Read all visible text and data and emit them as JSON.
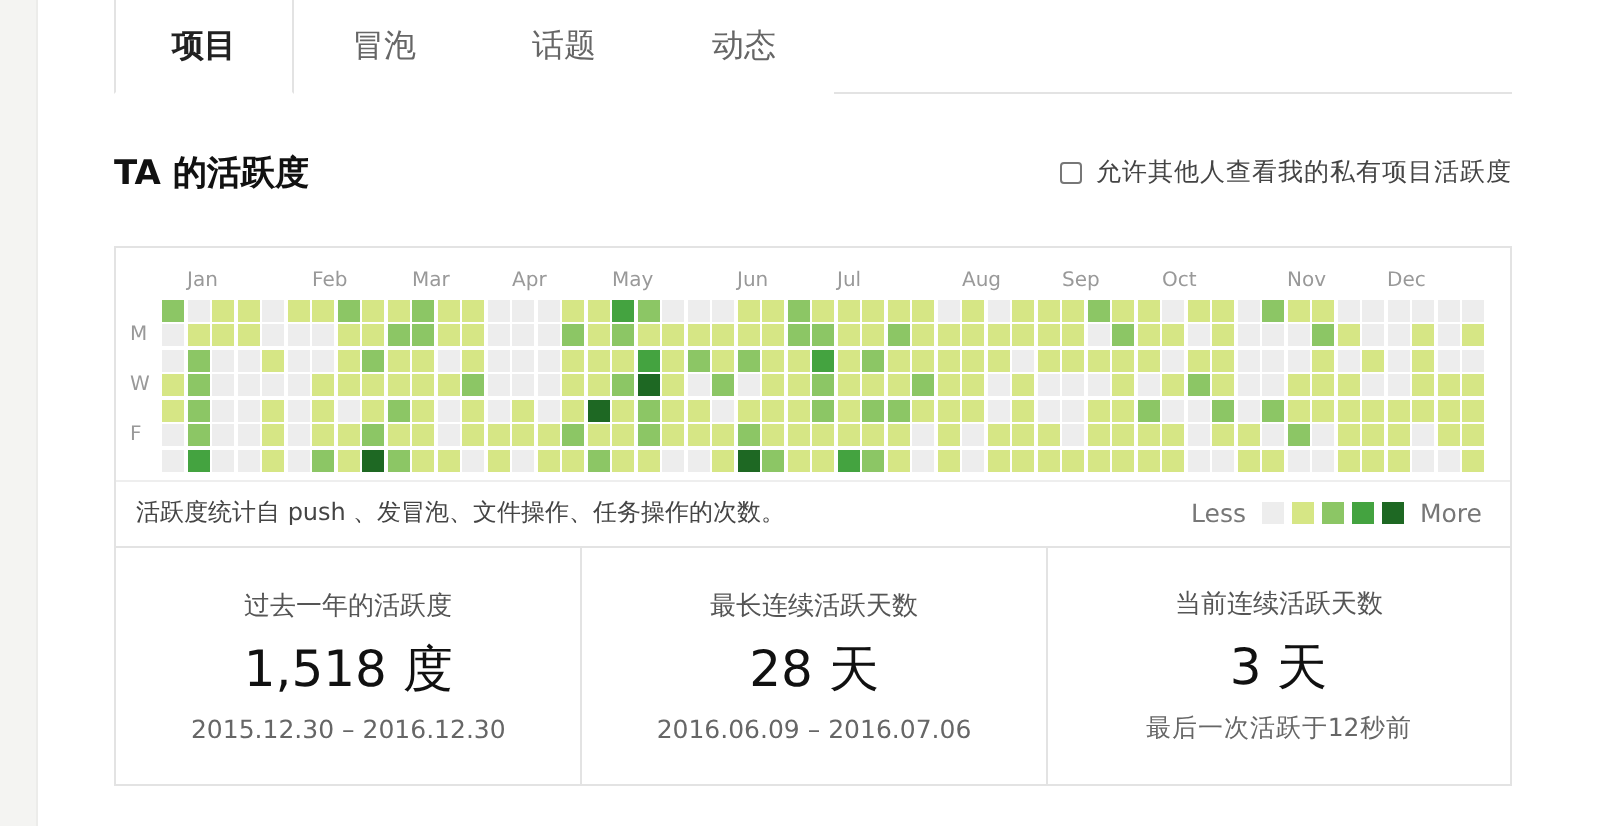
{
  "tabs": [
    {
      "label": "项目",
      "selected": true
    },
    {
      "label": "冒泡",
      "selected": false
    },
    {
      "label": "话题",
      "selected": false
    },
    {
      "label": "动态",
      "selected": false
    }
  ],
  "section": {
    "title": "TA 的活跃度",
    "privacy_option": {
      "label": "允许其他人查看我的私有项目活跃度",
      "checked": false
    }
  },
  "activity_grid": {
    "months": [
      "Jan",
      "Feb",
      "Mar",
      "Apr",
      "May",
      "Jun",
      "Jul",
      "Aug",
      "Sep",
      "Oct",
      "Nov",
      "Dec"
    ],
    "day_labels": [
      "M",
      "W",
      "F"
    ],
    "rows": [
      {
        "cells": [
          {
            "color": "#8cc665"
          },
          {
            "color": "#ededed"
          },
          {
            "color": "#d6e685"
          },
          {
            "color": "#d6e685"
          },
          {
            "color": "#ededed"
          },
          {
            "color": "#d6e685"
          },
          {
            "color": "#d6e685"
          },
          {
            "color": "#8cc665"
          },
          {
            "color": "#d6e685"
          },
          {
            "color": "#d6e685"
          },
          {
            "color": "#8cc665"
          },
          {
            "color": "#d6e685"
          },
          {
            "color": "#d6e685"
          },
          {
            "color": "#ededed"
          },
          {
            "color": "#ededed"
          },
          {
            "color": "#ededed"
          },
          {
            "color": "#d6e685"
          },
          {
            "color": "#d6e685"
          },
          {
            "color": "#44a340"
          },
          {
            "color": "#8cc665"
          },
          {
            "color": "#ededed"
          },
          {
            "color": "#ededed"
          },
          {
            "color": "#ededed"
          },
          {
            "color": "#d6e685"
          },
          {
            "color": "#d6e685"
          },
          {
            "color": "#8cc665"
          },
          {
            "color": "#d6e685"
          },
          {
            "color": "#d6e685"
          },
          {
            "color": "#d6e685"
          },
          {
            "color": "#d6e685"
          },
          {
            "color": "#d6e685"
          },
          {
            "color": "#ededed"
          },
          {
            "color": "#d6e685"
          },
          {
            "color": "#ededed"
          },
          {
            "color": "#d6e685"
          },
          {
            "color": "#d6e685"
          },
          {
            "color": "#d6e685"
          },
          {
            "color": "#8cc665"
          },
          {
            "color": "#d6e685"
          },
          {
            "color": "#d6e685"
          },
          {
            "color": "#ededed"
          },
          {
            "color": "#d6e685"
          },
          {
            "color": "#d6e685"
          },
          {
            "color": "#ededed"
          },
          {
            "color": "#8cc665"
          },
          {
            "color": "#d6e685"
          },
          {
            "color": "#d6e685"
          },
          {
            "color": "#ededed"
          },
          {
            "color": "#ededed"
          },
          {
            "color": "#ededed"
          },
          {
            "color": "#ededed"
          },
          {
            "color": "#ededed"
          },
          {
            "color": "#ededed"
          }
        ]
      },
      {
        "cells": [
          {
            "color": "#ededed"
          },
          {
            "color": "#d6e685"
          },
          {
            "color": "#d6e685"
          },
          {
            "color": "#d6e685"
          },
          {
            "color": "#ededed"
          },
          {
            "color": "#ededed"
          },
          {
            "color": "#ededed"
          },
          {
            "color": "#d6e685"
          },
          {
            "color": "#d6e685"
          },
          {
            "color": "#8cc665"
          },
          {
            "color": "#8cc665"
          },
          {
            "color": "#d6e685"
          },
          {
            "color": "#d6e685"
          },
          {
            "color": "#ededed"
          },
          {
            "color": "#ededed"
          },
          {
            "color": "#ededed"
          },
          {
            "color": "#8cc665"
          },
          {
            "color": "#d6e685"
          },
          {
            "color": "#8cc665"
          },
          {
            "color": "#d6e685"
          },
          {
            "color": "#d6e685"
          },
          {
            "color": "#d6e685"
          },
          {
            "color": "#d6e685"
          },
          {
            "color": "#d6e685"
          },
          {
            "color": "#d6e685"
          },
          {
            "color": "#8cc665"
          },
          {
            "color": "#8cc665"
          },
          {
            "color": "#d6e685"
          },
          {
            "color": "#d6e685"
          },
          {
            "color": "#8cc665"
          },
          {
            "color": "#d6e685"
          },
          {
            "color": "#d6e685"
          },
          {
            "color": "#d6e685"
          },
          {
            "color": "#d6e685"
          },
          {
            "color": "#d6e685"
          },
          {
            "color": "#d6e685"
          },
          {
            "color": "#d6e685"
          },
          {
            "color": "#ededed"
          },
          {
            "color": "#8cc665"
          },
          {
            "color": "#d6e685"
          },
          {
            "color": "#d6e685"
          },
          {
            "color": "#ededed"
          },
          {
            "color": "#d6e685"
          },
          {
            "color": "#ededed"
          },
          {
            "color": "#ededed"
          },
          {
            "color": "#ededed"
          },
          {
            "color": "#8cc665"
          },
          {
            "color": "#d6e685"
          },
          {
            "color": "#ededed"
          },
          {
            "color": "#ededed"
          },
          {
            "color": "#d6e685"
          },
          {
            "color": "#ededed"
          },
          {
            "color": "#d6e685"
          }
        ]
      },
      {
        "cells": [
          {
            "color": "#ededed"
          },
          {
            "color": "#8cc665"
          },
          {
            "color": "#ededed"
          },
          {
            "color": "#ededed"
          },
          {
            "color": "#d6e685"
          },
          {
            "color": "#ededed"
          },
          {
            "color": "#ededed"
          },
          {
            "color": "#d6e685"
          },
          {
            "color": "#8cc665"
          },
          {
            "color": "#d6e685"
          },
          {
            "color": "#d6e685"
          },
          {
            "color": "#ededed"
          },
          {
            "color": "#d6e685"
          },
          {
            "color": "#ededed"
          },
          {
            "color": "#ededed"
          },
          {
            "color": "#ededed"
          },
          {
            "color": "#d6e685"
          },
          {
            "color": "#d6e685"
          },
          {
            "color": "#d6e685"
          },
          {
            "color": "#44a340"
          },
          {
            "color": "#d6e685"
          },
          {
            "color": "#8cc665"
          },
          {
            "color": "#d6e685"
          },
          {
            "color": "#8cc665"
          },
          {
            "color": "#d6e685"
          },
          {
            "color": "#d6e685"
          },
          {
            "color": "#44a340"
          },
          {
            "color": "#d6e685"
          },
          {
            "color": "#8cc665"
          },
          {
            "color": "#d6e685"
          },
          {
            "color": "#d6e685"
          },
          {
            "color": "#d6e685"
          },
          {
            "color": "#d6e685"
          },
          {
            "color": "#d6e685"
          },
          {
            "color": "#ededed"
          },
          {
            "color": "#d6e685"
          },
          {
            "color": "#d6e685"
          },
          {
            "color": "#d6e685"
          },
          {
            "color": "#d6e685"
          },
          {
            "color": "#d6e685"
          },
          {
            "color": "#ededed"
          },
          {
            "color": "#d6e685"
          },
          {
            "color": "#d6e685"
          },
          {
            "color": "#ededed"
          },
          {
            "color": "#ededed"
          },
          {
            "color": "#ededed"
          },
          {
            "color": "#d6e685"
          },
          {
            "color": "#ededed"
          },
          {
            "color": "#d6e685"
          },
          {
            "color": "#ededed"
          },
          {
            "color": "#d6e685"
          },
          {
            "color": "#ededed"
          },
          {
            "color": "#ededed"
          }
        ]
      },
      {
        "cells": [
          {
            "color": "#d6e685"
          },
          {
            "color": "#8cc665"
          },
          {
            "color": "#ededed"
          },
          {
            "color": "#ededed"
          },
          {
            "color": "#ededed"
          },
          {
            "color": "#ededed"
          },
          {
            "color": "#d6e685"
          },
          {
            "color": "#d6e685"
          },
          {
            "color": "#d6e685"
          },
          {
            "color": "#d6e685"
          },
          {
            "color": "#d6e685"
          },
          {
            "color": "#d6e685"
          },
          {
            "color": "#8cc665"
          },
          {
            "color": "#ededed"
          },
          {
            "color": "#ededed"
          },
          {
            "color": "#ededed"
          },
          {
            "color": "#d6e685"
          },
          {
            "color": "#d6e685"
          },
          {
            "color": "#8cc665"
          },
          {
            "color": "#1e6823"
          },
          {
            "color": "#d6e685"
          },
          {
            "color": "#ededed"
          },
          {
            "color": "#8cc665"
          },
          {
            "color": "#ededed"
          },
          {
            "color": "#d6e685"
          },
          {
            "color": "#d6e685"
          },
          {
            "color": "#8cc665"
          },
          {
            "color": "#d6e685"
          },
          {
            "color": "#d6e685"
          },
          {
            "color": "#d6e685"
          },
          {
            "color": "#8cc665"
          },
          {
            "color": "#d6e685"
          },
          {
            "color": "#d6e685"
          },
          {
            "color": "#ededed"
          },
          {
            "color": "#d6e685"
          },
          {
            "color": "#ededed"
          },
          {
            "color": "#ededed"
          },
          {
            "color": "#ededed"
          },
          {
            "color": "#d6e685"
          },
          {
            "color": "#ededed"
          },
          {
            "color": "#d6e685"
          },
          {
            "color": "#8cc665"
          },
          {
            "color": "#d6e685"
          },
          {
            "color": "#ededed"
          },
          {
            "color": "#ededed"
          },
          {
            "color": "#d6e685"
          },
          {
            "color": "#d6e685"
          },
          {
            "color": "#d6e685"
          },
          {
            "color": "#ededed"
          },
          {
            "color": "#ededed"
          },
          {
            "color": "#d6e685"
          },
          {
            "color": "#d6e685"
          },
          {
            "color": "#d6e685"
          }
        ]
      },
      {
        "cells": [
          {
            "color": "#d6e685"
          },
          {
            "color": "#8cc665"
          },
          {
            "color": "#ededed"
          },
          {
            "color": "#ededed"
          },
          {
            "color": "#d6e685"
          },
          {
            "color": "#ededed"
          },
          {
            "color": "#d6e685"
          },
          {
            "color": "#ededed"
          },
          {
            "color": "#d6e685"
          },
          {
            "color": "#8cc665"
          },
          {
            "color": "#d6e685"
          },
          {
            "color": "#ededed"
          },
          {
            "color": "#d6e685"
          },
          {
            "color": "#ededed"
          },
          {
            "color": "#d6e685"
          },
          {
            "color": "#ededed"
          },
          {
            "color": "#d6e685"
          },
          {
            "color": "#1e6823"
          },
          {
            "color": "#d6e685"
          },
          {
            "color": "#8cc665"
          },
          {
            "color": "#d6e685"
          },
          {
            "color": "#d6e685"
          },
          {
            "color": "#ededed"
          },
          {
            "color": "#d6e685"
          },
          {
            "color": "#d6e685"
          },
          {
            "color": "#d6e685"
          },
          {
            "color": "#8cc665"
          },
          {
            "color": "#d6e685"
          },
          {
            "color": "#8cc665"
          },
          {
            "color": "#8cc665"
          },
          {
            "color": "#d6e685"
          },
          {
            "color": "#d6e685"
          },
          {
            "color": "#d6e685"
          },
          {
            "color": "#ededed"
          },
          {
            "color": "#d6e685"
          },
          {
            "color": "#ededed"
          },
          {
            "color": "#ededed"
          },
          {
            "color": "#d6e685"
          },
          {
            "color": "#d6e685"
          },
          {
            "color": "#8cc665"
          },
          {
            "color": "#ededed"
          },
          {
            "color": "#ededed"
          },
          {
            "color": "#8cc665"
          },
          {
            "color": "#ededed"
          },
          {
            "color": "#8cc665"
          },
          {
            "color": "#d6e685"
          },
          {
            "color": "#d6e685"
          },
          {
            "color": "#d6e685"
          },
          {
            "color": "#d6e685"
          },
          {
            "color": "#d6e685"
          },
          {
            "color": "#d6e685"
          },
          {
            "color": "#d6e685"
          },
          {
            "color": "#d6e685"
          }
        ]
      },
      {
        "cells": [
          {
            "color": "#ededed"
          },
          {
            "color": "#8cc665"
          },
          {
            "color": "#ededed"
          },
          {
            "color": "#ededed"
          },
          {
            "color": "#d6e685"
          },
          {
            "color": "#ededed"
          },
          {
            "color": "#d6e685"
          },
          {
            "color": "#d6e685"
          },
          {
            "color": "#8cc665"
          },
          {
            "color": "#d6e685"
          },
          {
            "color": "#d6e685"
          },
          {
            "color": "#ededed"
          },
          {
            "color": "#d6e685"
          },
          {
            "color": "#d6e685"
          },
          {
            "color": "#d6e685"
          },
          {
            "color": "#d6e685"
          },
          {
            "color": "#8cc665"
          },
          {
            "color": "#d6e685"
          },
          {
            "color": "#d6e685"
          },
          {
            "color": "#8cc665"
          },
          {
            "color": "#d6e685"
          },
          {
            "color": "#d6e685"
          },
          {
            "color": "#d6e685"
          },
          {
            "color": "#8cc665"
          },
          {
            "color": "#d6e685"
          },
          {
            "color": "#d6e685"
          },
          {
            "color": "#d6e685"
          },
          {
            "color": "#d6e685"
          },
          {
            "color": "#d6e685"
          },
          {
            "color": "#d6e685"
          },
          {
            "color": "#ededed"
          },
          {
            "color": "#d6e685"
          },
          {
            "color": "#ededed"
          },
          {
            "color": "#d6e685"
          },
          {
            "color": "#d6e685"
          },
          {
            "color": "#d6e685"
          },
          {
            "color": "#ededed"
          },
          {
            "color": "#d6e685"
          },
          {
            "color": "#d6e685"
          },
          {
            "color": "#d6e685"
          },
          {
            "color": "#d6e685"
          },
          {
            "color": "#ededed"
          },
          {
            "color": "#d6e685"
          },
          {
            "color": "#d6e685"
          },
          {
            "color": "#ededed"
          },
          {
            "color": "#8cc665"
          },
          {
            "color": "#ededed"
          },
          {
            "color": "#d6e685"
          },
          {
            "color": "#d6e685"
          },
          {
            "color": "#d6e685"
          },
          {
            "color": "#ededed"
          },
          {
            "color": "#d6e685"
          },
          {
            "color": "#d6e685"
          }
        ]
      },
      {
        "cells": [
          {
            "color": "#ededed"
          },
          {
            "color": "#44a340"
          },
          {
            "color": "#ededed"
          },
          {
            "color": "#ededed"
          },
          {
            "color": "#d6e685"
          },
          {
            "color": "#ededed"
          },
          {
            "color": "#8cc665"
          },
          {
            "color": "#d6e685"
          },
          {
            "color": "#1e6823"
          },
          {
            "color": "#8cc665"
          },
          {
            "color": "#d6e685"
          },
          {
            "color": "#d6e685"
          },
          {
            "color": "#ededed"
          },
          {
            "color": "#d6e685"
          },
          {
            "color": "#ededed"
          },
          {
            "color": "#d6e685"
          },
          {
            "color": "#d6e685"
          },
          {
            "color": "#8cc665"
          },
          {
            "color": "#d6e685"
          },
          {
            "color": "#d6e685"
          },
          {
            "color": "#ededed"
          },
          {
            "color": "#ededed"
          },
          {
            "color": "#d6e685"
          },
          {
            "color": "#1e6823"
          },
          {
            "color": "#8cc665"
          },
          {
            "color": "#d6e685"
          },
          {
            "color": "#d6e685"
          },
          {
            "color": "#44a340"
          },
          {
            "color": "#8cc665"
          },
          {
            "color": "#d6e685"
          },
          {
            "color": "#ededed"
          },
          {
            "color": "#d6e685"
          },
          {
            "color": "#ededed"
          },
          {
            "color": "#d6e685"
          },
          {
            "color": "#d6e685"
          },
          {
            "color": "#d6e685"
          },
          {
            "color": "#d6e685"
          },
          {
            "color": "#d6e685"
          },
          {
            "color": "#d6e685"
          },
          {
            "color": "#d6e685"
          },
          {
            "color": "#d6e685"
          },
          {
            "color": "#ededed"
          },
          {
            "color": "#ededed"
          },
          {
            "color": "#d6e685"
          },
          {
            "color": "#d6e685"
          },
          {
            "color": "#ededed"
          },
          {
            "color": "#ededed"
          },
          {
            "color": "#d6e685"
          },
          {
            "color": "#d6e685"
          },
          {
            "color": "#d6e685"
          },
          {
            "color": "#ededed"
          },
          {
            "color": "#ededed"
          },
          {
            "color": "#d6e685"
          }
        ]
      }
    ]
  },
  "caption": "活跃度统计自 push 、发冒泡、文件操作、任务操作的次数。",
  "legend": {
    "less": "Less",
    "more": "More"
  },
  "stats": [
    {
      "label": "过去一年的活跃度",
      "value": "1,518 度",
      "detail": "2015.12.30 – 2016.12.30"
    },
    {
      "label": "最长连续活跃天数",
      "value": "28 天",
      "detail": "2016.06.09 – 2016.07.06"
    },
    {
      "label": "当前连续活跃天数",
      "value": "3 天",
      "detail": "最后一次活跃于12秒前"
    }
  ]
}
